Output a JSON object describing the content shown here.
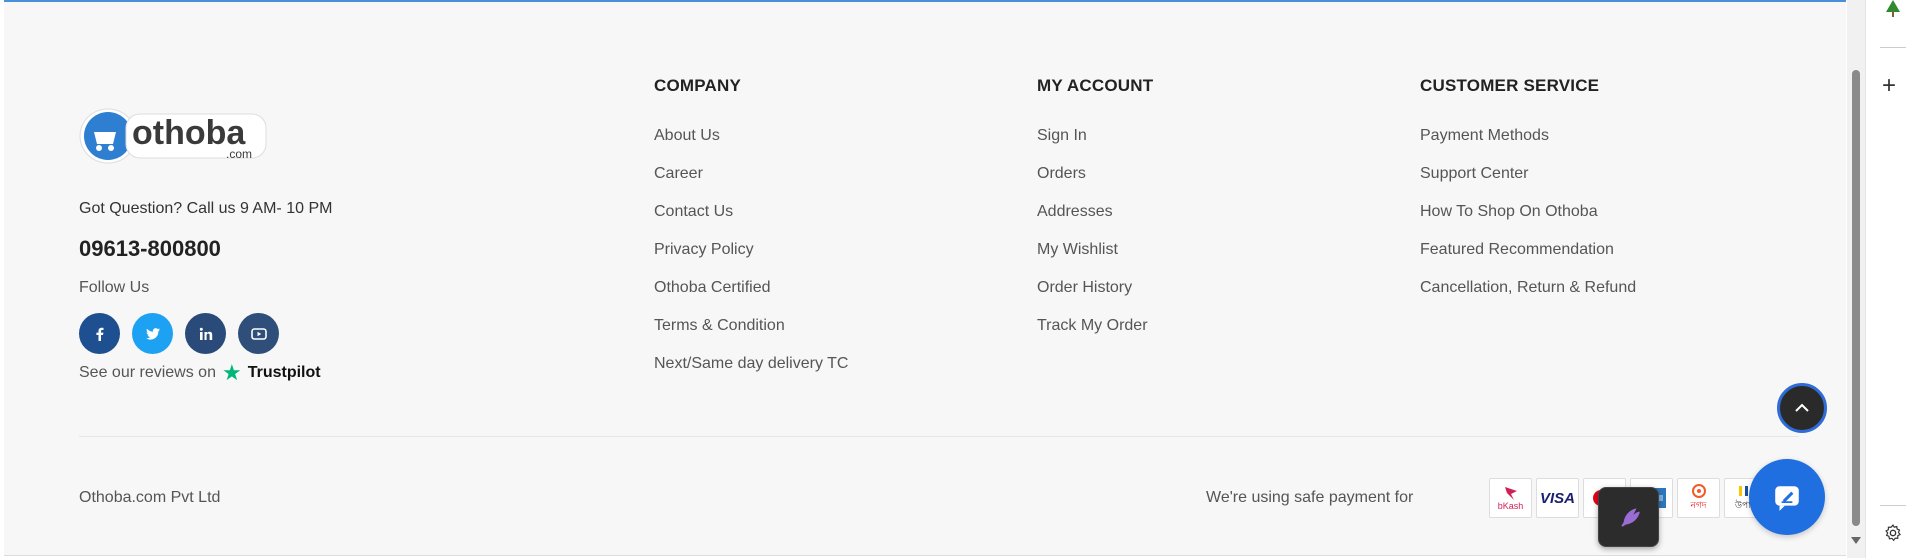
{
  "brand": {
    "logo_text": "othoba",
    "logo_sub": ".com",
    "question": "Got Question? Call us 9 AM- 10 PM",
    "phone": "09613-800800",
    "follow_label": "Follow Us",
    "socials": [
      {
        "name": "facebook",
        "icon": "facebook-icon"
      },
      {
        "name": "twitter",
        "icon": "twitter-icon"
      },
      {
        "name": "linkedin",
        "icon": "linkedin-icon"
      },
      {
        "name": "youtube",
        "icon": "youtube-icon"
      }
    ],
    "reviews_text": "See our reviews on",
    "trustpilot": "Trustpilot"
  },
  "columns": [
    {
      "title": "COMPANY",
      "links": [
        "About Us",
        "Career",
        "Contact Us",
        "Privacy Policy",
        "Othoba Certified",
        "Terms & Condition",
        "Next/Same day delivery TC"
      ]
    },
    {
      "title": "MY ACCOUNT",
      "links": [
        "Sign In",
        "Orders",
        "Addresses",
        "My Wishlist",
        "Order History",
        "Track My Order"
      ]
    },
    {
      "title": "CUSTOMER SERVICE",
      "links": [
        "Payment Methods",
        "Support Center",
        "How To Shop On Othoba",
        "Featured Recommendation",
        "Cancellation, Return & Refund"
      ]
    }
  ],
  "bottom": {
    "copyright": "Othoba.com Pvt Ltd",
    "safe_payment": "We're using safe payment for",
    "payment_methods": [
      {
        "name": "bKash",
        "label": "bKash"
      },
      {
        "name": "visa",
        "label": "VISA"
      },
      {
        "name": "mastercard",
        "label": ""
      },
      {
        "name": "amex",
        "label": ""
      },
      {
        "name": "nagad",
        "label": "নগদ"
      },
      {
        "name": "upay",
        "label": "উপায়"
      }
    ]
  },
  "colors": {
    "accent": "#1f6fe0",
    "footer_bg": "#f7f7f7",
    "trustpilot_green": "#00b67a"
  }
}
